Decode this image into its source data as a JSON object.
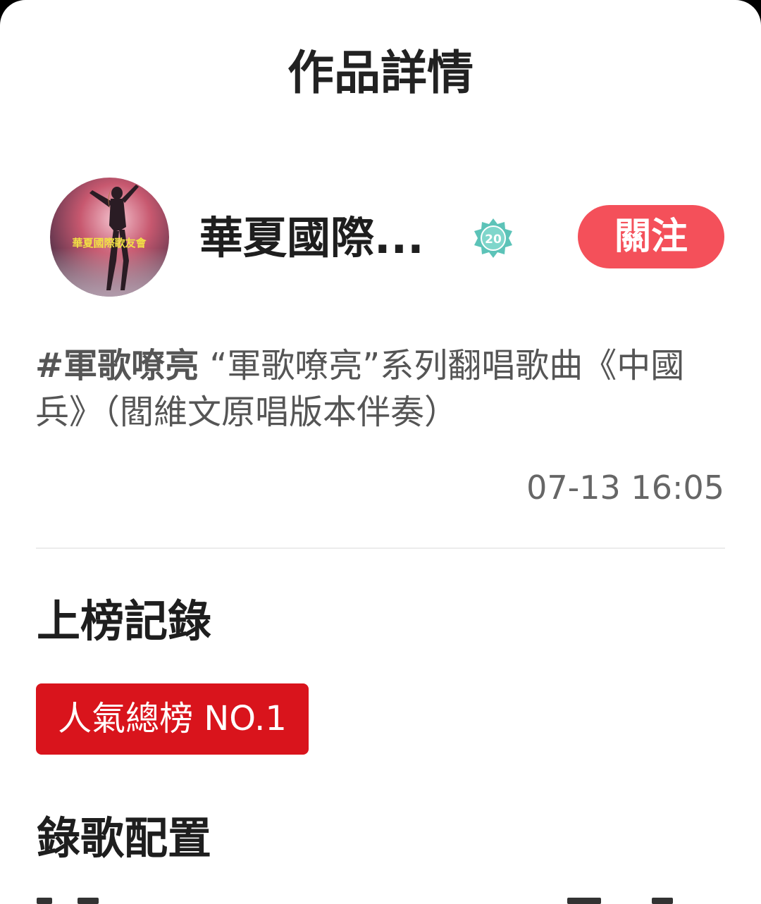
{
  "header": {
    "title": "作品詳情"
  },
  "user": {
    "avatar_text": "華夏國際歌友會",
    "name": "華夏國際...",
    "level_badge": "20",
    "level_badge_icon": "level-medal-icon",
    "follow_label": "關注"
  },
  "post": {
    "hashtag": "#軍歌嘹亮",
    "description": " “軍歌嘹亮”系列翻唱歌曲《中國兵》（閻維文原唱版本伴奏）",
    "timestamp": "07-13 16:05"
  },
  "ranking": {
    "section_title": "上榜記錄",
    "badge": "人氣總榜 NO.1"
  },
  "recording": {
    "section_title": "錄歌配置"
  },
  "colors": {
    "follow_button": "#f4505a",
    "rank_badge": "#d9141c",
    "badge_teal": "#5cc3b8"
  }
}
